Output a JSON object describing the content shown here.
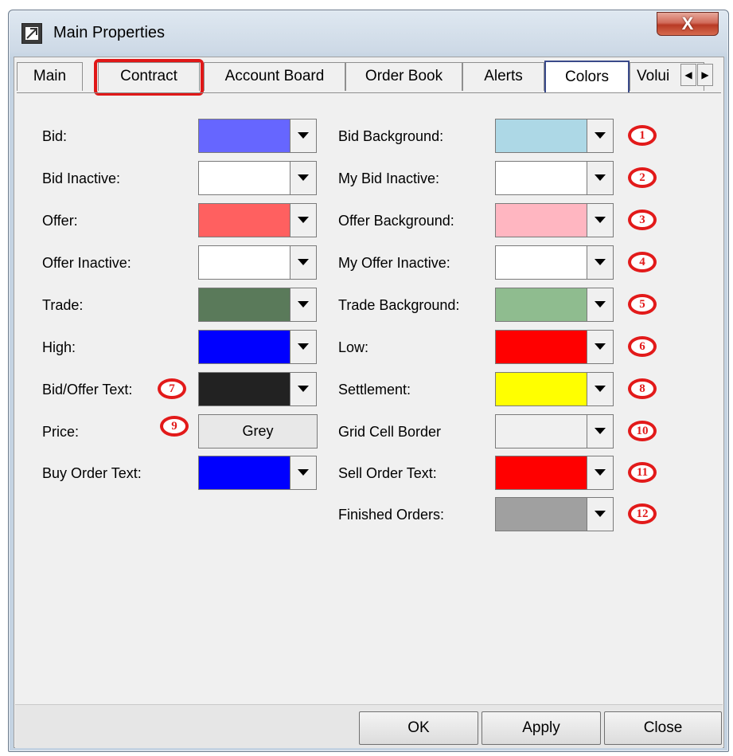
{
  "window": {
    "title": "Main Properties",
    "close_glyph": "X"
  },
  "tabs": [
    {
      "label": "Main"
    },
    {
      "label": "Contract"
    },
    {
      "label": "Account Board"
    },
    {
      "label": "Order Book"
    },
    {
      "label": "Alerts"
    },
    {
      "label": "Colors"
    },
    {
      "label": "Volui"
    }
  ],
  "active_tab": "Colors",
  "highlighted_tab": "Contract",
  "left_column": [
    {
      "label": "Bid:",
      "color": "#6666ff"
    },
    {
      "label": "Bid Inactive:",
      "color": "#ffffff"
    },
    {
      "label": "Offer:",
      "color": "#ff6060"
    },
    {
      "label": "Offer Inactive:",
      "color": "#ffffff"
    },
    {
      "label": "Trade:",
      "color": "#5a7a5a"
    },
    {
      "label": "High:",
      "color": "#0000ff"
    },
    {
      "label": "Bid/Offer Text:",
      "color": "#222222",
      "marker": "7"
    },
    {
      "label": "Price:",
      "button": "Grey",
      "marker": "9"
    },
    {
      "label": "Buy Order Text:",
      "color": "#0000ff"
    }
  ],
  "right_column": [
    {
      "label": "Bid Background:",
      "color": "#add8e6",
      "marker": "1"
    },
    {
      "label": "My Bid Inactive:",
      "color": "#ffffff",
      "marker": "2"
    },
    {
      "label": "Offer Background:",
      "color": "#ffb6c1",
      "marker": "3"
    },
    {
      "label": "My Offer Inactive:",
      "color": "#ffffff",
      "marker": "4"
    },
    {
      "label": "Trade Background:",
      "color": "#8fbc8f",
      "marker": "5"
    },
    {
      "label": "Low:",
      "color": "#ff0000",
      "marker": "6"
    },
    {
      "label": "Settlement:",
      "color": "#ffff00",
      "marker": "8"
    },
    {
      "label": "Grid Cell Border",
      "color": "#f0f0f0",
      "marker": "10"
    },
    {
      "label": "Sell Order Text:",
      "color": "#ff0000",
      "marker": "11"
    },
    {
      "label": "Finished Orders:",
      "color": "#a0a0a0",
      "marker": "12"
    }
  ],
  "buttons": {
    "ok": "OK",
    "apply": "Apply",
    "close": "Close"
  }
}
